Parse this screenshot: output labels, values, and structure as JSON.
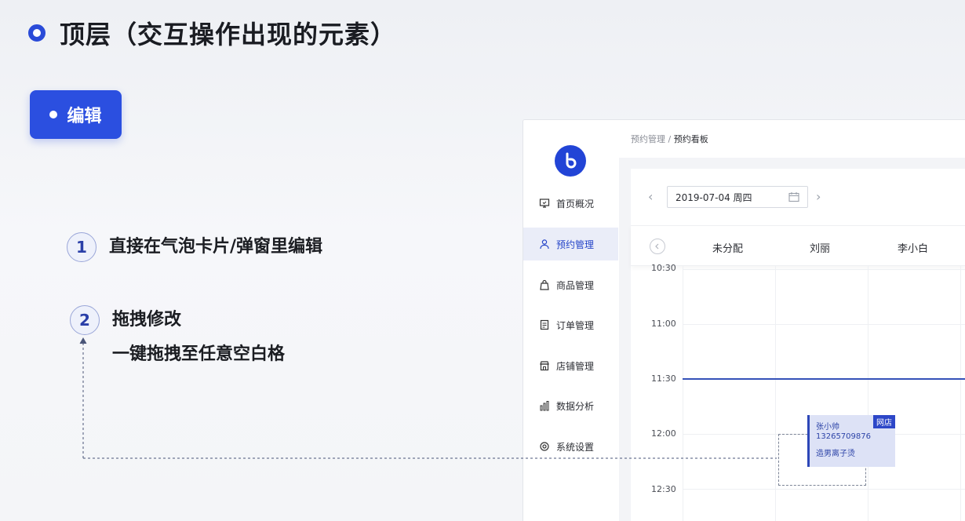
{
  "slide": {
    "title": "顶层（交互操作出现的元素）",
    "badge_label": "编辑",
    "points": [
      {
        "num": "1",
        "title": "直接在气泡卡片/弹窗里编辑"
      },
      {
        "num": "2",
        "title": "拖拽修改",
        "subtitle": "一键拖拽至任意空白格"
      }
    ]
  },
  "app": {
    "breadcrumb": {
      "parent": "预约管理",
      "sep": "/",
      "current": "预约看板"
    },
    "nav": [
      {
        "label": "首页概况",
        "icon": "monitor-icon"
      },
      {
        "label": "预约管理",
        "icon": "user-icon",
        "active": true
      },
      {
        "label": "商品管理",
        "icon": "bag-icon"
      },
      {
        "label": "订单管理",
        "icon": "document-icon"
      },
      {
        "label": "店铺管理",
        "icon": "store-icon"
      },
      {
        "label": "数据分析",
        "icon": "bar-chart-icon"
      },
      {
        "label": "系统设置",
        "icon": "settings-icon"
      }
    ],
    "date_picker": {
      "value": "2019-07-04 周四",
      "prev": "‹",
      "next": "›"
    },
    "columns": [
      "未分配",
      "刘丽",
      "李小白"
    ],
    "times": [
      "10:30",
      "11:00",
      "11:30",
      "12:00",
      "12:30"
    ],
    "appointment": {
      "name": "张小帅",
      "phone": "13265709876",
      "service": "造男离子烫",
      "tag": "网店"
    },
    "colors": {
      "accent": "#2b4fe0",
      "active_nav_bg": "#eaedf8",
      "appointment_bg": "#dde2f6"
    }
  }
}
